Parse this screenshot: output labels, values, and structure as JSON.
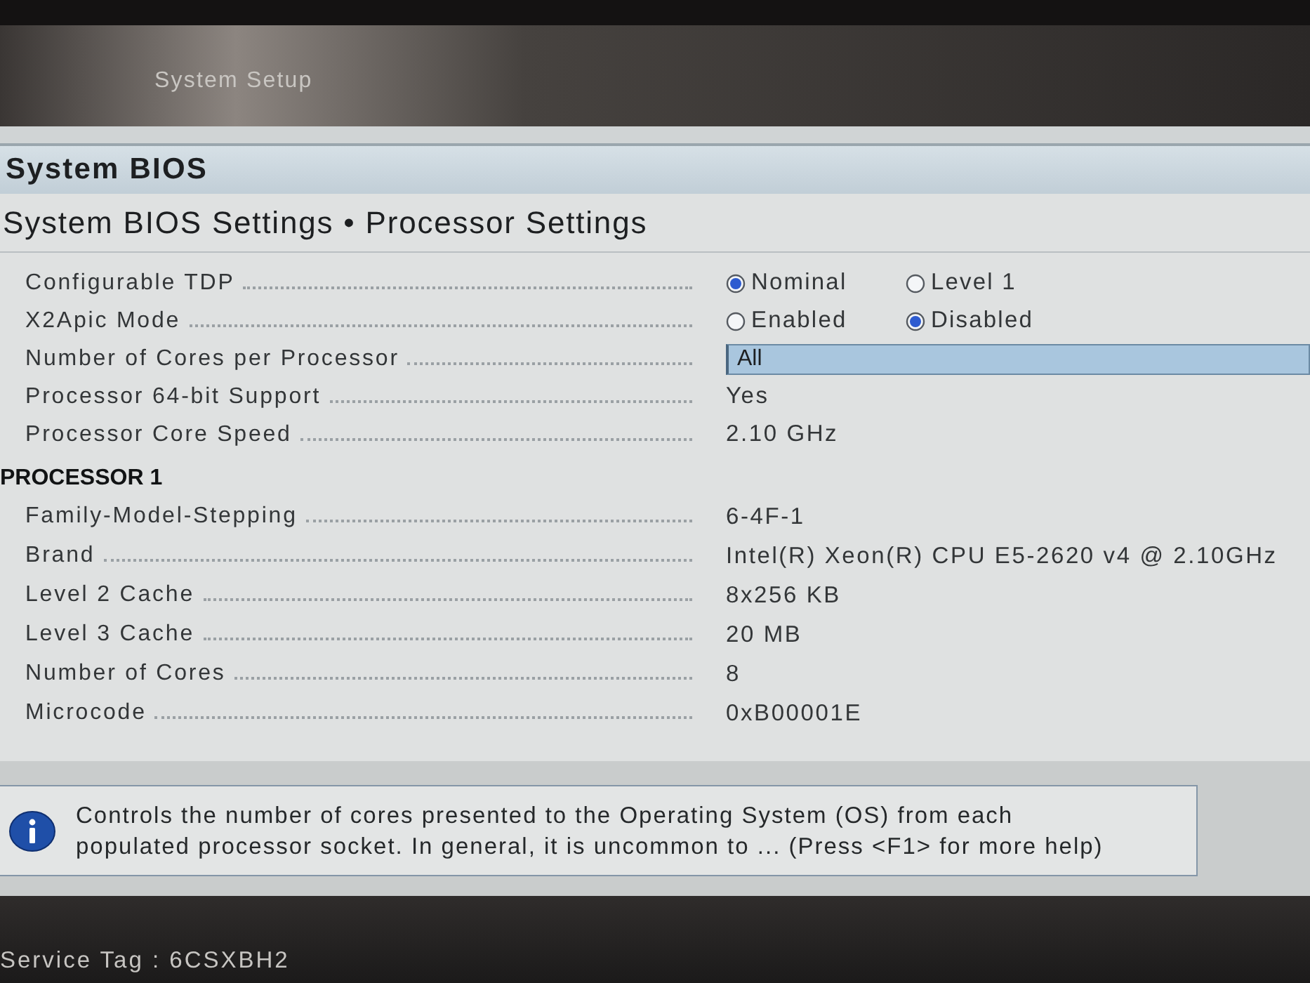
{
  "header": {
    "title": "System Setup"
  },
  "page_title": "System BIOS",
  "breadcrumb": "System BIOS Settings • Processor Settings",
  "settings": [
    {
      "kind": "radio",
      "label": "Configurable TDP",
      "options": [
        {
          "label": "Nominal",
          "selected": true
        },
        {
          "label": "Level 1",
          "selected": false
        }
      ]
    },
    {
      "kind": "radio",
      "label": "X2Apic Mode",
      "options": [
        {
          "label": "Enabled",
          "selected": false
        },
        {
          "label": "Disabled",
          "selected": true
        }
      ]
    },
    {
      "kind": "dropdown",
      "label": "Number of Cores per Processor",
      "value": "All",
      "focused": true
    },
    {
      "kind": "text",
      "label": "Processor 64-bit Support",
      "value": "Yes"
    },
    {
      "kind": "text",
      "label": "Processor Core Speed",
      "value": "2.10 GHz"
    }
  ],
  "sections": [
    {
      "title": "PROCESSOR 1",
      "items": [
        {
          "label": "Family-Model-Stepping",
          "value": "6-4F-1"
        },
        {
          "label": "Brand",
          "value": "Intel(R) Xeon(R) CPU E5-2620 v4 @ 2.10GHz"
        },
        {
          "label": "Level 2 Cache",
          "value": "8x256 KB"
        },
        {
          "label": "Level 3 Cache",
          "value": "20 MB"
        },
        {
          "label": "Number of Cores",
          "value": "8"
        },
        {
          "label": "Microcode",
          "value": "0xB00001E"
        }
      ]
    }
  ],
  "help": {
    "text": "Controls the number of cores presented to the Operating System (OS) from each populated processor socket. In general, it is uncommon to ... (Press <F1> for more help)"
  },
  "footer": {
    "service_tag": "Service Tag : 6CSXBH2"
  }
}
